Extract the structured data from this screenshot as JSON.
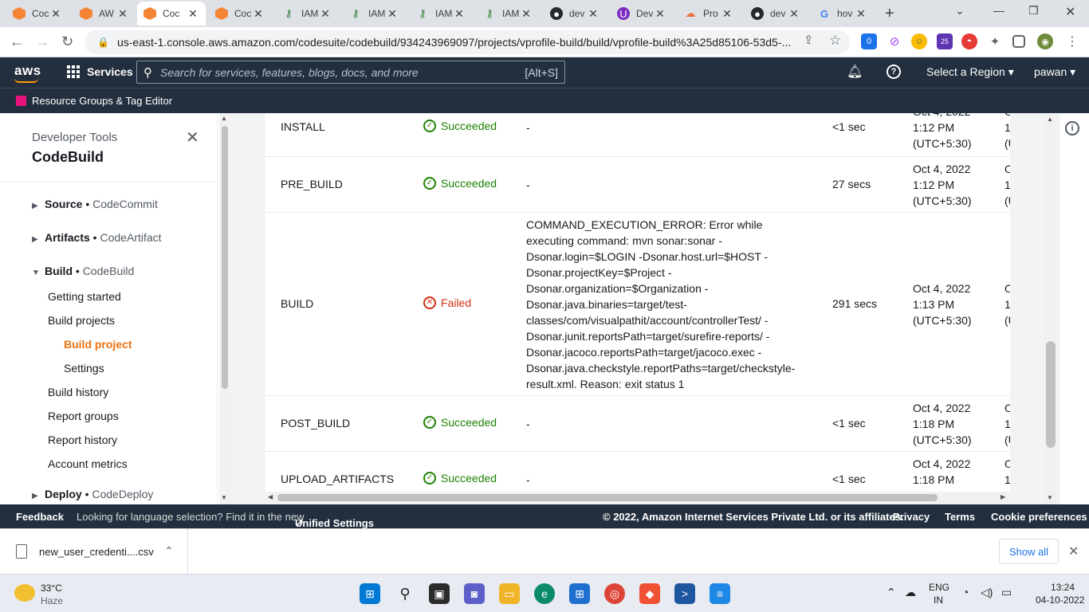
{
  "browser": {
    "tabs": [
      {
        "title": "Coc",
        "icon": "aws-icon"
      },
      {
        "title": "AW",
        "icon": "aws-icon"
      },
      {
        "title": "Coc",
        "icon": "aws-icon"
      },
      {
        "title": "Coc",
        "icon": "aws-icon"
      },
      {
        "title": "IAM",
        "icon": "key-icon"
      },
      {
        "title": "IAM",
        "icon": "key-icon"
      },
      {
        "title": "IAM",
        "icon": "key-icon"
      },
      {
        "title": "IAM",
        "icon": "key-icon"
      },
      {
        "title": "dev",
        "icon": "github-icon"
      },
      {
        "title": "Dev",
        "icon": "udemy-icon"
      },
      {
        "title": "Pro",
        "icon": "cloud-icon"
      },
      {
        "title": "dev",
        "icon": "github-icon"
      },
      {
        "title": "hov",
        "icon": "google-icon"
      }
    ],
    "active_tab_index": 2,
    "new_tab": "+",
    "url": "us-east-1.console.aws.amazon.com/codesuite/codebuild/934243969097/projects/vprofile-build/build/vprofile-build%3A25d85106-53d5-...",
    "extension_badges": {
      "first": "0",
      "second": "25"
    }
  },
  "aws_nav": {
    "logo": "aws",
    "services_label": "Services",
    "search_placeholder": "Search for services, features, blogs, docs, and more",
    "search_shortcut": "[Alt+S]",
    "region_label": "Select a Region",
    "user_label": "pawan",
    "resource_groups_label": "Resource Groups & Tag Editor"
  },
  "sidebar": {
    "subtitle": "Developer Tools",
    "title": "CodeBuild",
    "sections": [
      {
        "name": "Source",
        "service": "CodeCommit",
        "expanded": false
      },
      {
        "name": "Artifacts",
        "service": "CodeArtifact",
        "expanded": false
      },
      {
        "name": "Build",
        "service": "CodeBuild",
        "expanded": true
      },
      {
        "name": "Deploy",
        "service": "CodeDeploy",
        "expanded": false
      }
    ],
    "build_links": [
      {
        "label": "Getting started",
        "level": 1,
        "active": false
      },
      {
        "label": "Build projects",
        "level": 1,
        "active": false
      },
      {
        "label": "Build project",
        "level": 2,
        "active": true
      },
      {
        "label": "Settings",
        "level": 2,
        "active": false
      },
      {
        "label": "Build history",
        "level": 1,
        "active": false
      },
      {
        "label": "Report groups",
        "level": 1,
        "active": false
      },
      {
        "label": "Report history",
        "level": 1,
        "active": false
      },
      {
        "label": "Account metrics",
        "level": 1,
        "active": false
      }
    ],
    "separator": "•"
  },
  "phases": [
    {
      "name": "INSTALL",
      "status": "Succeeded",
      "context": "-",
      "duration": "<1 sec",
      "start": [
        "Oct 4, 2022",
        "1:12 PM",
        "(UTC+5:30)"
      ],
      "end": [
        "O",
        "1",
        "(U"
      ]
    },
    {
      "name": "PRE_BUILD",
      "status": "Succeeded",
      "context": "-",
      "duration": "27 secs",
      "start": [
        "Oct 4, 2022",
        "1:12 PM",
        "(UTC+5:30)"
      ],
      "end": [
        "O",
        "1",
        "(U"
      ]
    },
    {
      "name": "BUILD",
      "status": "Failed",
      "context": [
        "COMMAND_EXECUTION_ERROR: Error while",
        "executing command: mvn sonar:sonar -",
        "Dsonar.login=$LOGIN -Dsonar.host.url=$HOST -",
        "Dsonar.projectKey=$Project -",
        "Dsonar.organization=$Organization -",
        "Dsonar.java.binaries=target/test-",
        "classes/com/visualpathit/account/controllerTest/ -",
        "Dsonar.junit.reportsPath=target/surefire-reports/ -",
        "Dsonar.jacoco.reportsPath=target/jacoco.exec -",
        "Dsonar.java.checkstyle.reportPaths=target/checkstyle-",
        "result.xml. Reason: exit status 1"
      ],
      "duration": "291 secs",
      "start": [
        "Oct 4, 2022",
        "1:13 PM",
        "(UTC+5:30)"
      ],
      "end": [
        "O",
        "1",
        "(U"
      ]
    },
    {
      "name": "POST_BUILD",
      "status": "Succeeded",
      "context": "-",
      "duration": "<1 sec",
      "start": [
        "Oct 4, 2022",
        "1:18 PM",
        "(UTC+5:30)"
      ],
      "end": [
        "O",
        "1",
        "(U"
      ]
    },
    {
      "name": "UPLOAD_ARTIFACTS",
      "status": "Succeeded",
      "context": "-",
      "duration": "<1 sec",
      "start": [
        "Oct 4, 2022",
        "1:18 PM"
      ],
      "end": [
        "O",
        "1"
      ]
    }
  ],
  "footer": {
    "feedback": "Feedback",
    "language_prompt": "Looking for language selection? Find it in the new",
    "unified_settings": "Unified Settings",
    "copyright": "© 2022, Amazon Internet Services Private Ltd. or its affiliates.",
    "privacy": "Privacy",
    "terms": "Terms",
    "cookie": "Cookie preferences"
  },
  "downloads": {
    "file_name": "new_user_credenti....csv",
    "show_all": "Show all"
  },
  "taskbar": {
    "temperature": "33°C",
    "weather": "Haze",
    "lang_top": "ENG",
    "lang_bottom": "IN",
    "time": "13:24",
    "date": "04-10-2022"
  },
  "colors": {
    "aws_nav_bg": "#232f3e",
    "active_link": "#ec7211",
    "success": "#1d8102",
    "failed": "#d13212"
  }
}
